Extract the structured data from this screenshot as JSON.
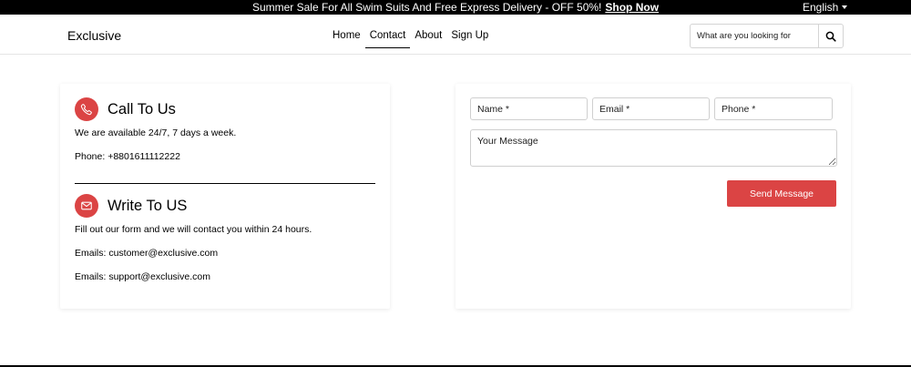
{
  "topbar": {
    "promo_text": "Summer Sale For All Swim Suits And Free Express Delivery - OFF 50%!",
    "promo_link": "Shop Now",
    "language": "English"
  },
  "header": {
    "logo": "Exclusive",
    "nav": [
      {
        "label": "Home"
      },
      {
        "label": "Contact",
        "active": true
      },
      {
        "label": "About"
      },
      {
        "label": "Sign Up"
      }
    ],
    "search_placeholder": "What are you looking for"
  },
  "contact_info": {
    "call": {
      "title": "Call To Us",
      "desc": "We are available 24/7, 7 days a week.",
      "phone": "Phone: +8801611112222",
      "icon": "phone-icon"
    },
    "write": {
      "title": "Write To US",
      "desc": "Fill out our form and we will contact you within 24 hours.",
      "email1": "Emails: customer@exclusive.com",
      "email2": "Emails: support@exclusive.com",
      "icon": "mail-icon"
    }
  },
  "form": {
    "name_placeholder": "Name *",
    "email_placeholder": "Email *",
    "phone_placeholder": "Phone *",
    "message_placeholder": "Your Message",
    "send_label": "Send Message"
  },
  "colors": {
    "accent": "#db4444",
    "topbar_bg": "#000000"
  }
}
